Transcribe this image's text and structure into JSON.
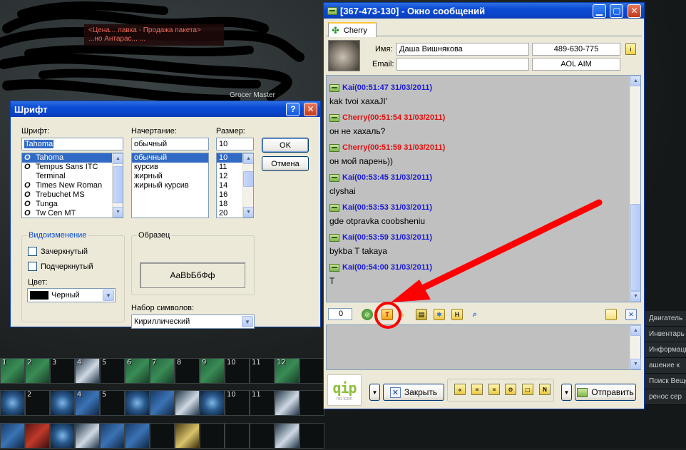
{
  "game": {
    "banner_lines": [
      "<Цена... лавка - Продажа пакета>",
      "...но Антарас... ..."
    ],
    "npc_label": "Grocer Master",
    "skillbars": [
      {
        "slots": [
          {
            "num": "1",
            "icon": "sword-skill-icon",
            "color": "green"
          },
          {
            "num": "2",
            "icon": "sword-skill-icon",
            "color": "green"
          },
          {
            "num": "3",
            "icon": "empty-slot-icon",
            "color": "empty"
          },
          {
            "num": "4",
            "icon": "running-man-icon",
            "color": "white"
          },
          {
            "num": "5",
            "icon": "empty-slot-icon",
            "color": "empty"
          },
          {
            "num": "6",
            "icon": "sword-skill-icon",
            "color": "green"
          },
          {
            "num": "7",
            "icon": "crossed-swords-icon",
            "color": "green"
          },
          {
            "num": "8",
            "icon": "empty-slot-icon",
            "color": "empty"
          },
          {
            "num": "9",
            "icon": "chest-icon",
            "color": "green"
          },
          {
            "num": "10",
            "icon": "empty-slot-icon",
            "color": "empty"
          },
          {
            "num": "11",
            "icon": "empty-slot-icon",
            "color": "empty"
          },
          {
            "num": "12",
            "icon": "sword-skill-icon",
            "color": "green"
          },
          {
            "num": "",
            "icon": "empty-slot-icon",
            "color": "empty"
          }
        ]
      },
      {
        "slots": [
          {
            "num": "",
            "icon": "spiral-skill-icon",
            "color": "spiral"
          },
          {
            "num": "2",
            "icon": "empty-slot-icon",
            "color": "empty"
          },
          {
            "num": "",
            "icon": "spiral-skill-icon",
            "color": "spiral"
          },
          {
            "num": "4",
            "icon": "feet-skill-icon",
            "color": "blue"
          },
          {
            "num": "5",
            "icon": "empty-slot-icon",
            "color": "empty"
          },
          {
            "num": "",
            "icon": "spiral-skill-icon",
            "color": "spiral"
          },
          {
            "num": "",
            "icon": "crowd-skill-icon",
            "color": "blue"
          },
          {
            "num": "",
            "icon": "light-pillar-icon",
            "color": "white"
          },
          {
            "num": "",
            "icon": "spiral-skill-icon",
            "color": "spiral"
          },
          {
            "num": "10",
            "icon": "empty-slot-icon",
            "color": "empty"
          },
          {
            "num": "11",
            "icon": "empty-slot-icon",
            "color": "empty"
          },
          {
            "num": "",
            "icon": "running-man-icon",
            "color": "white"
          },
          {
            "num": "",
            "icon": "empty-slot-icon",
            "color": "empty"
          }
        ]
      },
      {
        "slots": [
          {
            "num": "",
            "icon": "blade-skill-icon",
            "color": "blue"
          },
          {
            "num": "",
            "icon": "fist-skill-icon",
            "color": "red"
          },
          {
            "num": "",
            "icon": "spiral-skill-icon",
            "color": "spiral"
          },
          {
            "num": "",
            "icon": "axe-skill-icon",
            "color": "white"
          },
          {
            "num": "",
            "icon": "potion-icon",
            "color": "blue"
          },
          {
            "num": "",
            "icon": "hand-skill-icon",
            "color": "blue"
          },
          {
            "num": "",
            "icon": "empty-slot-icon",
            "color": "empty"
          },
          {
            "num": "",
            "icon": "key-icon",
            "color": "gold"
          },
          {
            "num": "",
            "icon": "empty-slot-icon",
            "color": "empty"
          },
          {
            "num": "",
            "icon": "empty-slot-icon",
            "color": "empty"
          },
          {
            "num": "",
            "icon": "empty-slot-icon",
            "color": "empty"
          },
          {
            "num": "",
            "icon": "staff-skill-icon",
            "color": "white"
          },
          {
            "num": "",
            "icon": "empty-slot-icon",
            "color": "empty"
          }
        ]
      }
    ],
    "side_menu": [
      "Двигатель",
      "Инвентарь",
      "Информация",
      "ашение к",
      "Поиск Вещей",
      "ренос сер"
    ]
  },
  "font_dialog": {
    "title": "Шрифт",
    "font_label": "Шрифт:",
    "font_value": "Tahoma",
    "fonts": [
      "Tahoma",
      "Tempus Sans ITC",
      "Terminal",
      "Times New Roman",
      "Trebuchet MS",
      "Tunga",
      "Tw Cen MT"
    ],
    "font_icons": [
      "O",
      "O",
      "",
      "O",
      "O",
      "O",
      "O"
    ],
    "style_label": "Начертание:",
    "style_value": "обычный",
    "styles": [
      "обычный",
      "курсив",
      "жирный",
      "жирный курсив"
    ],
    "size_label": "Размер:",
    "size_value": "10",
    "sizes": [
      "10",
      "11",
      "12",
      "14",
      "16",
      "18",
      "20"
    ],
    "ok_label": "OK",
    "cancel_label": "Отмена",
    "effects_title": "Видоизменение",
    "strikeout_label": "Зачеркнутый",
    "underline_label": "Подчеркнутый",
    "color_label": "Цвет:",
    "color_value": "Черный",
    "color_swatch": "#000000",
    "sample_title": "Образец",
    "sample_text": "AaBbБбФф",
    "charset_label": "Набор символов:",
    "charset_value": "Кириллический"
  },
  "message_window": {
    "title": "[367-473-130] - Окно сообщений",
    "tab_label": "Cherry",
    "name_label": "Имя:",
    "name_value": "Даша  Вишнякова",
    "uin_value": "489-630-775",
    "email_label": "Email:",
    "email_value": "",
    "protocol_value": "AOL AIM",
    "messages": [
      {
        "sender": "Kai",
        "time": "(00:51:47 31/03/2011)",
        "text": "kak tvoi xaxaJI'",
        "color": "#1a1ad6"
      },
      {
        "sender": "Cherry",
        "time": "(00:51:54 31/03/2011)",
        "text": "он не хахаль?",
        "color": "#e01010"
      },
      {
        "sender": "Cherry",
        "time": "(00:51:59 31/03/2011)",
        "text": "он мой парень))",
        "color": "#e01010"
      },
      {
        "sender": "Kai",
        "time": "(00:53:45 31/03/2011)",
        "text": "clyshai",
        "color": "#1a1ad6"
      },
      {
        "sender": "Kai",
        "time": "(00:53:53 31/03/2011)",
        "text": "gde otpravka coobsheniu",
        "color": "#1a1ad6"
      },
      {
        "sender": "Kai",
        "time": "(00:53:59 31/03/2011)",
        "text": "bykba T takaya",
        "color": "#1a1ad6"
      },
      {
        "sender": "Kai",
        "time": "(00:54:00 31/03/2011)",
        "text": "T",
        "color": "#1a1ad6"
      }
    ],
    "char_counter": "0",
    "input_text": "",
    "logo_text": "qip",
    "logo_sub": "no icon",
    "close_label": "Закрыть",
    "send_label": "Отправить",
    "mini_icons": [
      "«",
      "≡",
      "≡",
      "⚙",
      "▢",
      "N"
    ]
  },
  "colors": {
    "accent_red": "#ff0000",
    "xp_blue": "#0b4bd6",
    "kai": "#1a1ad6",
    "cherry": "#e01010"
  }
}
